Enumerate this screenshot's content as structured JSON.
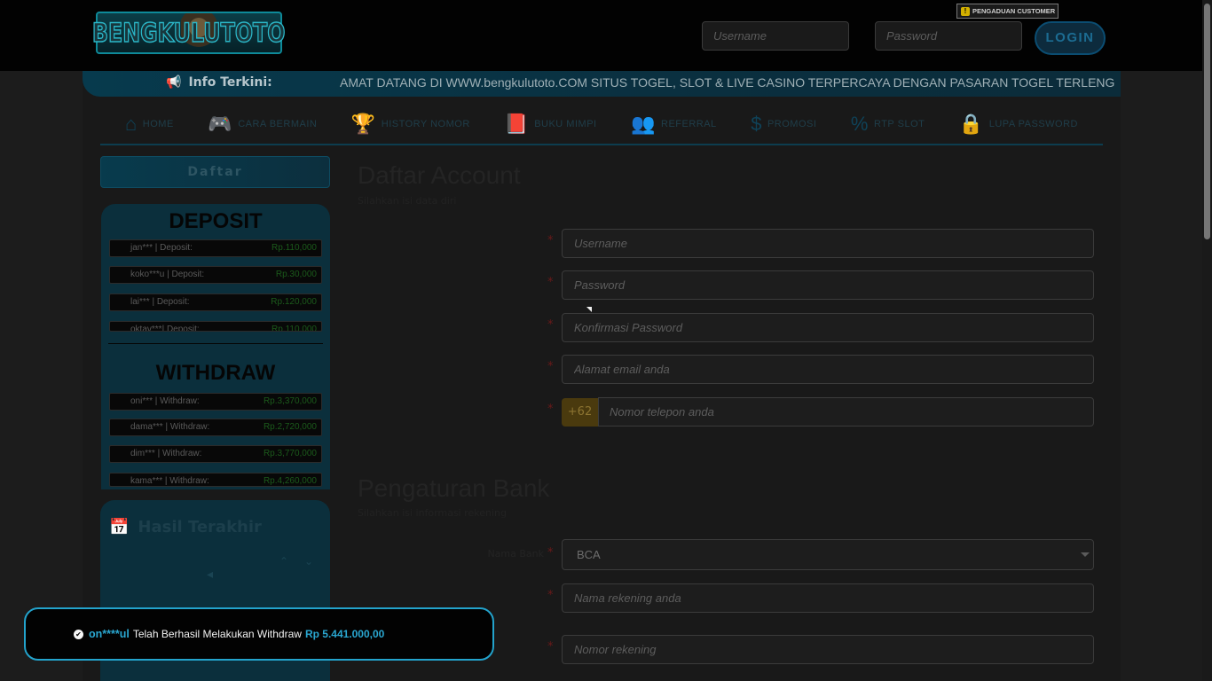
{
  "header": {
    "logo_text": "BENGKULUTOTO",
    "username_placeholder": "Username",
    "password_placeholder": "Password",
    "login_label": "LOGIN",
    "pengaduan_label": "PENGADUAN CUSTOMER"
  },
  "ticker": {
    "label": "Info Terkini:",
    "text": "AMAT DATANG DI WWW.bengkulutoto.COM SITUS TOGEL, SLOT & LIVE CASINO TERPERCAYA DENGAN PASARAN TOGEL TERLENG"
  },
  "nav": {
    "items": [
      {
        "label": "HOME",
        "icon": "home-icon"
      },
      {
        "label": "CARA BERMAIN",
        "icon": "gamepad-icon"
      },
      {
        "label": "HISTORY NOMOR",
        "icon": "trophy-icon"
      },
      {
        "label": "BUKU MIMPI",
        "icon": "book-icon"
      },
      {
        "label": "REFERRAL",
        "icon": "users-icon"
      },
      {
        "label": "PROMOSI",
        "icon": "dollar-icon"
      },
      {
        "label": "RTP SLOT",
        "icon": "percent-icon"
      },
      {
        "label": "LUPA PASSWORD",
        "icon": "lock-icon"
      }
    ]
  },
  "sidebar": {
    "daftar_label": "Daftar",
    "deposit_title": "DEPOSIT",
    "deposits": [
      {
        "user": "jan*** | Deposit:",
        "amount": "Rp.110,000"
      },
      {
        "user": "koko***u | Deposit:",
        "amount": "Rp.30,000"
      },
      {
        "user": "lai*** | Deposit:",
        "amount": "Rp.120,000"
      },
      {
        "user": "oktav***| Deposit:",
        "amount": "Rp.110,000"
      }
    ],
    "withdraw_title": "WITHDRAW",
    "withdraws": [
      {
        "user": "oni*** | Withdraw:",
        "amount": "Rp.3,370,000"
      },
      {
        "user": "dama*** | Withdraw:",
        "amount": "Rp.2,720,000"
      },
      {
        "user": "dim*** | Withdraw:",
        "amount": "Rp.3,770,000"
      },
      {
        "user": "kama*** | Withdraw:",
        "amount": "Rp.4,260,000"
      }
    ],
    "hasil_title": "Hasil Terakhir"
  },
  "form": {
    "title": "Daftar Account",
    "subtitle": "Silahkan isi data diri",
    "username_placeholder": "Username",
    "password_placeholder": "Password",
    "confirm_placeholder": "Konfirmasi Password",
    "email_placeholder": "Alamat email anda",
    "phone_prefix": "+62",
    "phone_placeholder": "Nomor telepon anda",
    "bank_title": "Pengaturan Bank",
    "bank_subtitle": "Silahkan isi informasi rekening",
    "bank_label": "Nama Bank",
    "bank_value": "BCA",
    "account_name_placeholder": "Nama rekening anda",
    "account_number_placeholder": "Nomor rekening"
  },
  "toast": {
    "user": "on****ul",
    "message": "Telah Berhasil Melakukan Withdraw",
    "amount": "Rp 5.441.000,00"
  }
}
